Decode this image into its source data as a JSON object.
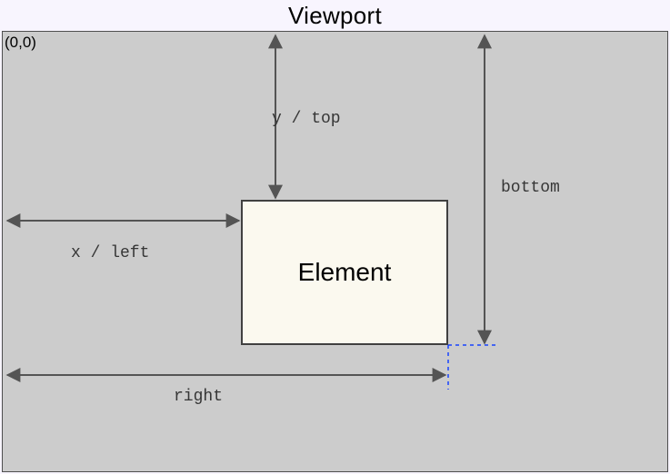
{
  "title": "Viewport",
  "origin_label": "(0,0)",
  "element_label": "Element",
  "labels": {
    "x_left": "x / left",
    "y_top": "y / top",
    "right": "right",
    "bottom": "bottom"
  }
}
